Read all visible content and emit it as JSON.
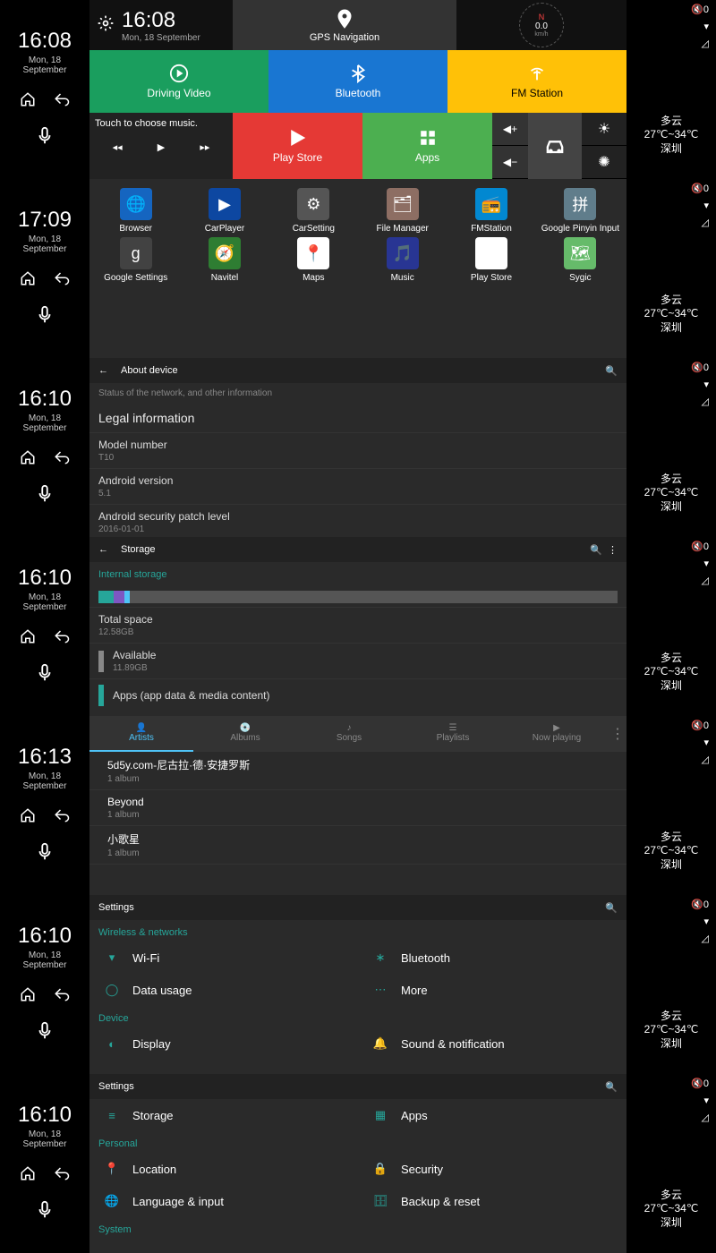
{
  "sidebar_status": {
    "mute": "0"
  },
  "weather": {
    "cond": "多云",
    "temp": "27℃~34℃",
    "city": "深圳"
  },
  "strips": [
    {
      "time": "16:08",
      "date1": "Mon, 18",
      "date2": "September"
    },
    {
      "time": "17:09",
      "date1": "Mon, 18",
      "date2": "September"
    },
    {
      "time": "16:10",
      "date1": "Mon, 18",
      "date2": "September"
    },
    {
      "time": "16:10",
      "date1": "Mon, 18",
      "date2": "September"
    },
    {
      "time": "16:13",
      "date1": "Mon, 18",
      "date2": "September"
    },
    {
      "time": "16:10",
      "date1": "Mon, 18",
      "date2": "September"
    },
    {
      "time": "16:10",
      "date1": "Mon, 18",
      "date2": "September"
    }
  ],
  "launcher": {
    "clock_time": "16:08",
    "clock_date": "Mon, 18 September",
    "gps_label": "GPS Navigation",
    "compass": {
      "dir": "N",
      "speed": "0.0",
      "unit": "km/h"
    },
    "tiles": {
      "driving": "Driving Video",
      "bt": "Bluetooth",
      "fm": "FM Station",
      "play": "Play Store",
      "apps": "Apps"
    },
    "music_hint": "Touch to choose music."
  },
  "apps": [
    {
      "name": "Browser",
      "bg": "#1565c0",
      "glyph": "🌐"
    },
    {
      "name": "CarPlayer",
      "bg": "#0d47a1",
      "glyph": "▶"
    },
    {
      "name": "CarSetting",
      "bg": "#555",
      "glyph": "⚙"
    },
    {
      "name": "File Manager",
      "bg": "#8d6e63",
      "glyph": "🗂"
    },
    {
      "name": "FMStation",
      "bg": "#0288d1",
      "glyph": "📻"
    },
    {
      "name": "Google Pinyin Input",
      "bg": "#607d8b",
      "glyph": "拼"
    },
    {
      "name": "Google Settings",
      "bg": "#424242",
      "glyph": "g"
    },
    {
      "name": "Navitel",
      "bg": "#2e7d32",
      "glyph": "🧭"
    },
    {
      "name": "Maps",
      "bg": "#fff",
      "glyph": "📍"
    },
    {
      "name": "Music",
      "bg": "#283593",
      "glyph": "🎵"
    },
    {
      "name": "Play Store",
      "bg": "#fff",
      "glyph": "▶"
    },
    {
      "name": "Sygic",
      "bg": "#66bb6a",
      "glyph": "🗺"
    }
  ],
  "about": {
    "title": "About device",
    "status_note": "Status of the network, and other information",
    "legal": "Legal information",
    "items": [
      {
        "k": "Model number",
        "v": "T10"
      },
      {
        "k": "Android version",
        "v": "5.1"
      },
      {
        "k": "Android security patch level",
        "v": "2016-01-01"
      }
    ]
  },
  "storage": {
    "title": "Storage",
    "internal": "Internal storage",
    "total_k": "Total space",
    "total_v": "12.58GB",
    "avail_k": "Available",
    "avail_v": "11.89GB",
    "apps_k": "Apps (app data & media content)",
    "segments": [
      {
        "color": "#26a69a",
        "pct": 3
      },
      {
        "color": "#7e57c2",
        "pct": 2
      },
      {
        "color": "#4fc3f7",
        "pct": 1
      }
    ]
  },
  "music": {
    "tabs": [
      "Artists",
      "Albums",
      "Songs",
      "Playlists",
      "Now playing"
    ],
    "active": 0,
    "artists": [
      {
        "name": "5d5y.com-尼古拉·德·安捷罗斯",
        "sub": "1 album"
      },
      {
        "name": "Beyond",
        "sub": "1 album"
      },
      {
        "name": "小歌星",
        "sub": "1 album"
      }
    ]
  },
  "settings": {
    "title": "Settings",
    "wireless_head": "Wireless & networks",
    "device_head": "Device",
    "personal_head": "Personal",
    "system_head": "System",
    "wifi": "Wi-Fi",
    "bt": "Bluetooth",
    "data": "Data usage",
    "more": "More",
    "display": "Display",
    "sound": "Sound & notification",
    "storage": "Storage",
    "apps": "Apps",
    "location": "Location",
    "security": "Security",
    "lang": "Language & input",
    "backup": "Backup & reset"
  }
}
